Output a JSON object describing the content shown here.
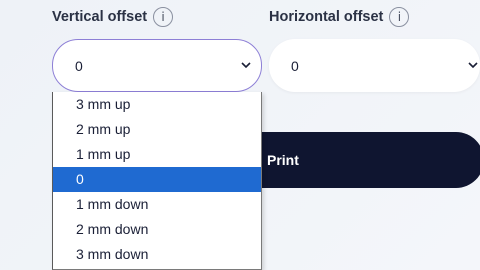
{
  "vertical_offset": {
    "label": "Vertical offset",
    "info_icon": "info-icon",
    "selected": "0",
    "options": [
      "3 mm up",
      "2 mm up",
      "1 mm up",
      "0",
      "1 mm down",
      "2 mm down",
      "3 mm down"
    ],
    "highlighted_index": 3
  },
  "horizontal_offset": {
    "label": "Horizontal offset",
    "info_icon": "info-icon",
    "selected": "0"
  },
  "print_button": {
    "label": "Print"
  },
  "colors": {
    "button_bg": "#0f1530",
    "highlight": "#1f6ad1",
    "focus_border": "#8d7fd6"
  }
}
